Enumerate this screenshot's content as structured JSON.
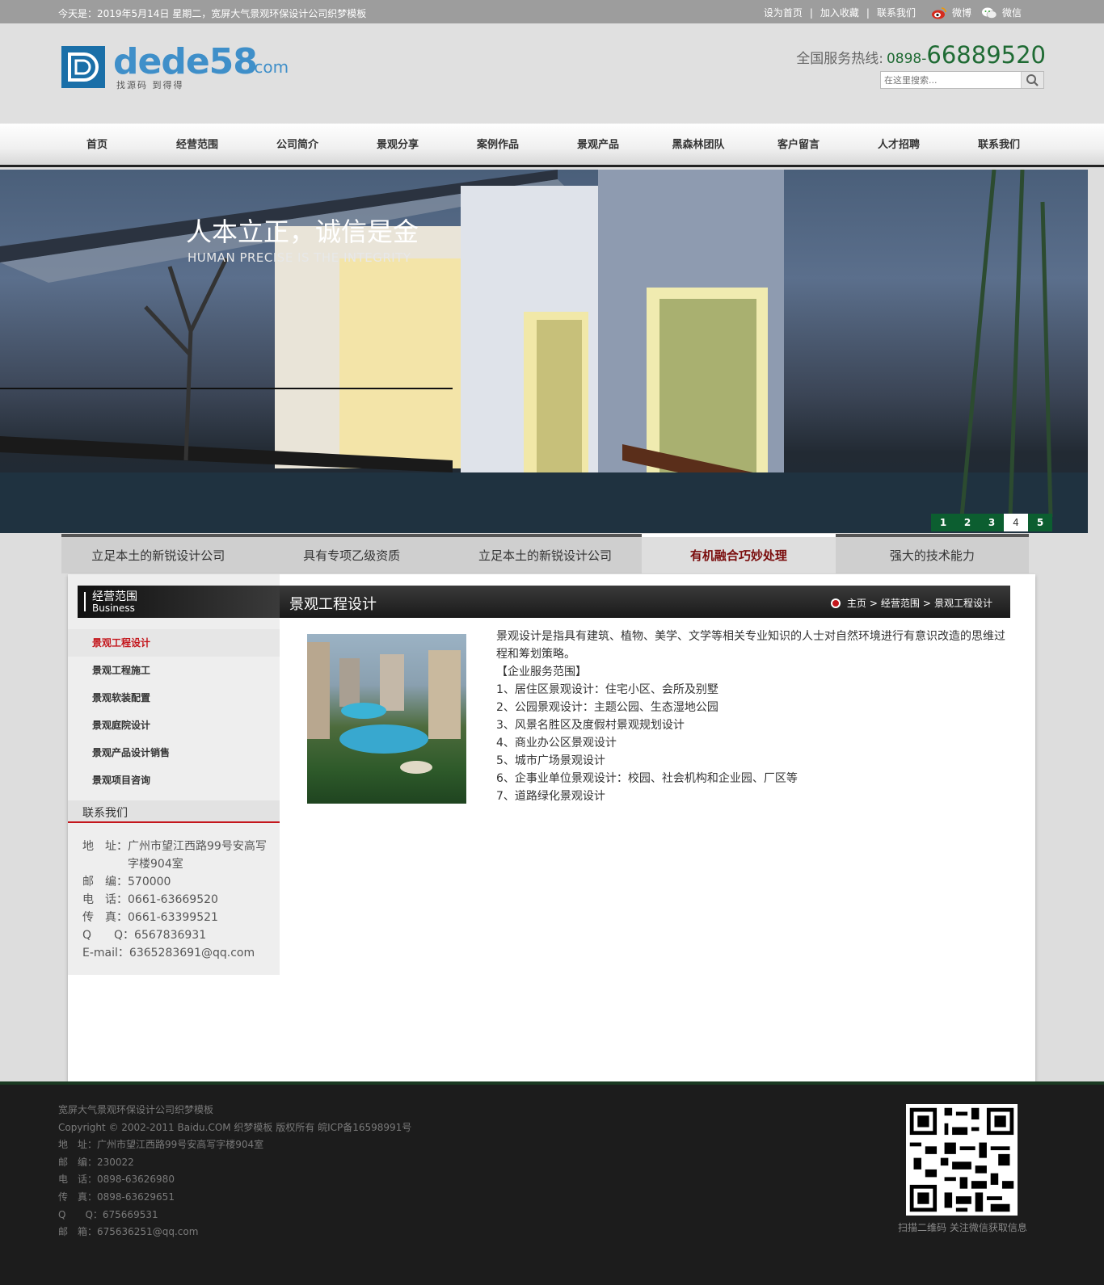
{
  "topbar": {
    "date": "今天是：2019年5月14日 星期二，宽屏大气景观环保设计公司织梦模板",
    "links": [
      "设为首页",
      "加入收藏",
      "联系我们"
    ],
    "separator": "|",
    "weibo": "微博",
    "wechat": "微信"
  },
  "header": {
    "logo_word": "dede58",
    "logo_tld": ".com",
    "logo_sub": "找源码 到得得",
    "hotline_label": "全国服务热线:",
    "hotline_prefix": "0898-",
    "hotline_number": "66889520",
    "search_placeholder": "在这里搜索..."
  },
  "nav": [
    "首页",
    "经营范围",
    "公司简介",
    "景观分享",
    "案例作品",
    "景观产品",
    "黑森林团队",
    "客户留言",
    "人才招聘",
    "联系我们"
  ],
  "banner": {
    "slogan": "人本立正，诚信是金",
    "slogan_en": "HUMAN PRECISE IS THE INTEGRITY",
    "dots": [
      "1",
      "2",
      "3",
      "4",
      "5"
    ],
    "active_dot": 3
  },
  "features": {
    "tabs": [
      "立足本土的新锐设计公司",
      "具有专项乙级资质",
      "立足本土的新锐设计公司",
      "有机融合巧妙处理",
      "强大的技术能力"
    ],
    "active": 3
  },
  "sidebar": {
    "head_cn": "经营范围",
    "head_en": "Business",
    "items": [
      "景观工程设计",
      "景观工程施工",
      "景观软装配置",
      "景观庭院设计",
      "景观产品设计销售",
      "景观项目咨询"
    ],
    "active": 0,
    "contact_title": "联系我们",
    "contact": [
      {
        "k": "地　址：",
        "v": "广州市望江西路99号安高写字楼904室"
      },
      {
        "k": "邮　编：",
        "v": "570000"
      },
      {
        "k": "电　话：",
        "v": "0661-63669520"
      },
      {
        "k": "传　真：",
        "v": "0661-63399521"
      },
      {
        "k": "Q　　Q：",
        "v": "6567836931"
      },
      {
        "k": "E-mail：",
        "v": "6365283691@qq.com"
      }
    ]
  },
  "content": {
    "title": "景观工程设计",
    "crumbs": [
      "主页",
      "经营范围",
      "景观工程设计"
    ],
    "crumb_sep": ">",
    "intro": "景观设计是指具有建筑、植物、美学、文学等相关专业知识的人士对自然环境进行有意识改造的思维过程和筹划策略。",
    "scope_title": "【企业服务范围】",
    "scope": [
      "1、居住区景观设计：住宅小区、会所及别墅",
      "2、公园景观设计：主题公园、生态湿地公园",
      "3、风景名胜区及度假村景观规划设计",
      "4、商业办公区景观设计",
      "5、城市广场景观设计",
      "6、企事业单位景观设计：校园、社会机构和企业园、厂区等",
      "7、道路绿化景观设计"
    ]
  },
  "footer": {
    "lines": [
      "宽屏大气景观环保设计公司织梦模板",
      "Copyright © 2002-2011 Baidu.COM 织梦模板 版权所有  皖ICP备16598991号",
      "地　址：广州市望江西路99号安高写字楼904室",
      "邮　编：230022",
      "电　话：0898-63626980",
      "传　真：0898-63629651",
      "Q　　Q：675669531",
      "邮　箱：675636251@qq.com"
    ],
    "qr_caption": "扫描二维码 关注微信获取信息"
  },
  "colors": {
    "accent_green": "#1f6b34",
    "accent_red": "#c4161c",
    "dot_green": "#0c5e30"
  }
}
